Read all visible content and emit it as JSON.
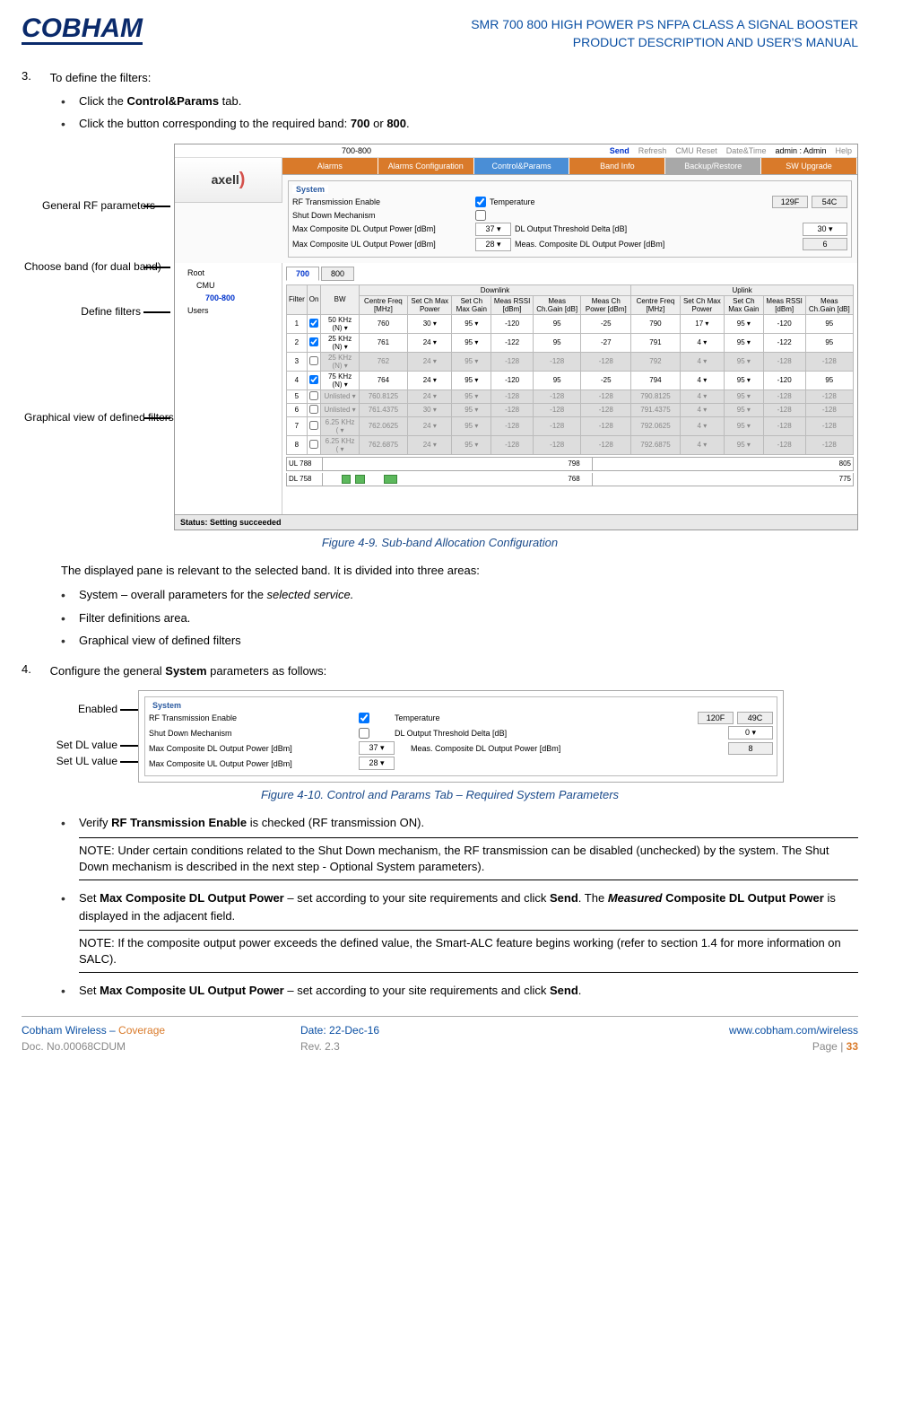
{
  "header": {
    "logo": "COBHAM",
    "title_line1": "SMR 700 800 HIGH POWER PS NFPA CLASS A SIGNAL BOOSTER",
    "title_line2": "PRODUCT DESCRIPTION AND USER'S MANUAL"
  },
  "step3": {
    "num": "3.",
    "text": "To define the filters:",
    "b1a": "Click the ",
    "b1b": "Control&Params",
    "b1c": " tab.",
    "b2a": "Click the button corresponding to the required band: ",
    "b2b": "700",
    "b2c": " or ",
    "b2d": "800",
    "b2e": "."
  },
  "callouts1": {
    "c1": "General RF parameters",
    "c2": "Choose band (for dual band)",
    "c3": "Define filters",
    "c4": "Graphical view of defined filters"
  },
  "shot1": {
    "top_band": "700-800",
    "send": "Send",
    "refresh": "Refresh",
    "cmu_reset": "CMU Reset",
    "datetime": "Date&Time",
    "admin": "admin : Admin",
    "help": "Help",
    "tabs": [
      "Alarms",
      "Alarms Configuration",
      "Control&Params",
      "Band Info",
      "Backup/Restore",
      "SW Upgrade"
    ],
    "axell": "axell",
    "tree": [
      "Root",
      "CMU",
      "700-800",
      "Users"
    ],
    "system_title": "System",
    "rf_enable": "RF Transmission Enable",
    "shutdown": "Shut Down Mechanism",
    "max_dl": "Max Composite DL Output Power [dBm]",
    "max_ul": "Max Composite UL Output Power [dBm]",
    "temp_label": "Temperature",
    "temp_f": "129F",
    "temp_c": "54C",
    "dl_thresh": "DL Output Threshold Delta [dB]",
    "dl_thresh_v": "30",
    "meas_dl": "Meas. Composite DL Output Power [dBm]",
    "meas_dl_v": "6",
    "dl_v": "37",
    "ul_v": "28",
    "subtab_700": "700",
    "subtab_800": "800",
    "dl_header": "Downlink",
    "ul_header": "Uplink",
    "cols": [
      "Filter",
      "On",
      "BW",
      "Centre Freq [MHz]",
      "Set Ch Max Power",
      "Set Ch Max Gain",
      "Meas RSSI [dBm]",
      "Meas Ch.Gain [dB]",
      "Meas Ch Power [dBm]",
      "Centre Freq [MHz]",
      "Set Ch Max Power",
      "Set Ch Max Gain",
      "Meas RSSI [dBm]",
      "Meas Ch.Gain [dB]"
    ],
    "rows": [
      {
        "f": "1",
        "on": true,
        "bw": "50 KHz (N) ▾",
        "cf": "760",
        "scmp": "30 ▾",
        "scmg": "95 ▾",
        "mr": "-120",
        "mcg": "95",
        "mcp": "-25",
        "cfu": "790",
        "scmpu": "17 ▾",
        "scmgu": "95 ▾",
        "mru": "-120",
        "mcgu": "95"
      },
      {
        "f": "2",
        "on": true,
        "bw": "25 KHz (N) ▾",
        "cf": "761",
        "scmp": "24 ▾",
        "scmg": "95 ▾",
        "mr": "-122",
        "mcg": "95",
        "mcp": "-27",
        "cfu": "791",
        "scmpu": "4 ▾",
        "scmgu": "95 ▾",
        "mru": "-122",
        "mcgu": "95"
      },
      {
        "f": "3",
        "on": false,
        "bw": "25 KHz (N) ▾",
        "cf": "762",
        "scmp": "24 ▾",
        "scmg": "95 ▾",
        "mr": "-128",
        "mcg": "-128",
        "mcp": "-128",
        "cfu": "792",
        "scmpu": "4 ▾",
        "scmgu": "95 ▾",
        "mru": "-128",
        "mcgu": "-128"
      },
      {
        "f": "4",
        "on": true,
        "bw": "75 KHz (N) ▾",
        "cf": "764",
        "scmp": "24 ▾",
        "scmg": "95 ▾",
        "mr": "-120",
        "mcg": "95",
        "mcp": "-25",
        "cfu": "794",
        "scmpu": "4 ▾",
        "scmgu": "95 ▾",
        "mru": "-120",
        "mcgu": "95"
      },
      {
        "f": "5",
        "on": false,
        "bw": "Unlisted ▾",
        "cf": "760.8125",
        "scmp": "24 ▾",
        "scmg": "95 ▾",
        "mr": "-128",
        "mcg": "-128",
        "mcp": "-128",
        "cfu": "790.8125",
        "scmpu": "4 ▾",
        "scmgu": "95 ▾",
        "mru": "-128",
        "mcgu": "-128"
      },
      {
        "f": "6",
        "on": false,
        "bw": "Unlisted ▾",
        "cf": "761.4375",
        "scmp": "30 ▾",
        "scmg": "95 ▾",
        "mr": "-128",
        "mcg": "-128",
        "mcp": "-128",
        "cfu": "791.4375",
        "scmpu": "4 ▾",
        "scmgu": "95 ▾",
        "mru": "-128",
        "mcgu": "-128"
      },
      {
        "f": "7",
        "on": false,
        "bw": "6.25 KHz ( ▾",
        "cf": "762.0625",
        "scmp": "24 ▾",
        "scmg": "95 ▾",
        "mr": "-128",
        "mcg": "-128",
        "mcp": "-128",
        "cfu": "792.0625",
        "scmpu": "4 ▾",
        "scmgu": "95 ▾",
        "mru": "-128",
        "mcgu": "-128"
      },
      {
        "f": "8",
        "on": false,
        "bw": "6.25 KHz ( ▾",
        "cf": "762.6875",
        "scmp": "24 ▾",
        "scmg": "95 ▾",
        "mr": "-128",
        "mcg": "-128",
        "mcp": "-128",
        "cfu": "792.6875",
        "scmpu": "4 ▾",
        "scmgu": "95 ▾",
        "mru": "-128",
        "mcgu": "-128"
      }
    ],
    "ul_left": "UL 788",
    "ul_mid": "798",
    "ul_right": "805",
    "dl_left": "DL 758",
    "dl_mid": "768",
    "dl_right": "775",
    "status": "Status: Setting succeeded"
  },
  "fig1": "Figure 4-9. Sub-band Allocation Configuration",
  "body1": {
    "p1": "The displayed pane is relevant to the selected band.  It is divided into three areas:",
    "b1a": "System – overall parameters for the ",
    "b1b": "selected service.",
    "b2": "Filter definitions area.",
    "b3": "Graphical view of defined filters"
  },
  "step4": {
    "num": "4.",
    "t1": "Configure the general ",
    "t2": "System",
    "t3": " parameters as follows:"
  },
  "callouts2": {
    "c1": "Enabled",
    "c2": "Set DL value",
    "c3": "Set UL value"
  },
  "shot2": {
    "title": "System",
    "rf": "RF Transmission Enable",
    "sd": "Shut Down Mechanism",
    "mdl": "Max Composite DL Output Power [dBm]",
    "mdl_v": "37",
    "mul": "Max Composite UL Output Power [dBm]",
    "mul_v": "28",
    "temp": "Temperature",
    "tf": "120F",
    "tc": "49C",
    "dth": "DL Output Threshold Delta [dB]",
    "dth_v": "0",
    "mcd": "Meas. Composite DL Output Power [dBm]",
    "mcd_v": "8"
  },
  "fig2": "Figure 4-10. Control and Params Tab – Required System Parameters",
  "body2": {
    "b1a": "Verify ",
    "b1b": "RF Transmission Enable",
    "b1c": " is checked (RF transmission ON).",
    "note1": "NOTE: Under certain conditions related to the Shut Down mechanism, the RF transmission can be disabled (unchecked) by the system.   The Shut Down mechanism is described in the next step - Optional System parameters).",
    "b2a": "Set ",
    "b2b": "Max Composite DL Output Power",
    "b2c": " – set according to your site requirements and click ",
    "b2d": "Send",
    "b2e": ". The ",
    "b2f": "Measured",
    "b2g": " Composite DL Output Power",
    "b2h": " is displayed in the adjacent field.",
    "note2": "NOTE: If the composite output power exceeds the defined value, the Smart-ALC feature begins working (refer to section 1.4 for more information on SALC).",
    "b3a": "Set ",
    "b3b": "Max Composite UL Output Power",
    "b3c": " – set according to your site requirements and click ",
    "b3d": "Send",
    "b3e": "."
  },
  "footer": {
    "l1a": "Cobham Wireless",
    "l1b": " – ",
    "l1c": "Coverage",
    "l2": "Doc. No.00068CDUM",
    "m1": "Date: 22-Dec-16",
    "m2": "Rev. 2.3",
    "r1": "www.cobham.com/wireless",
    "r2a": "Page | ",
    "r2b": "33"
  }
}
